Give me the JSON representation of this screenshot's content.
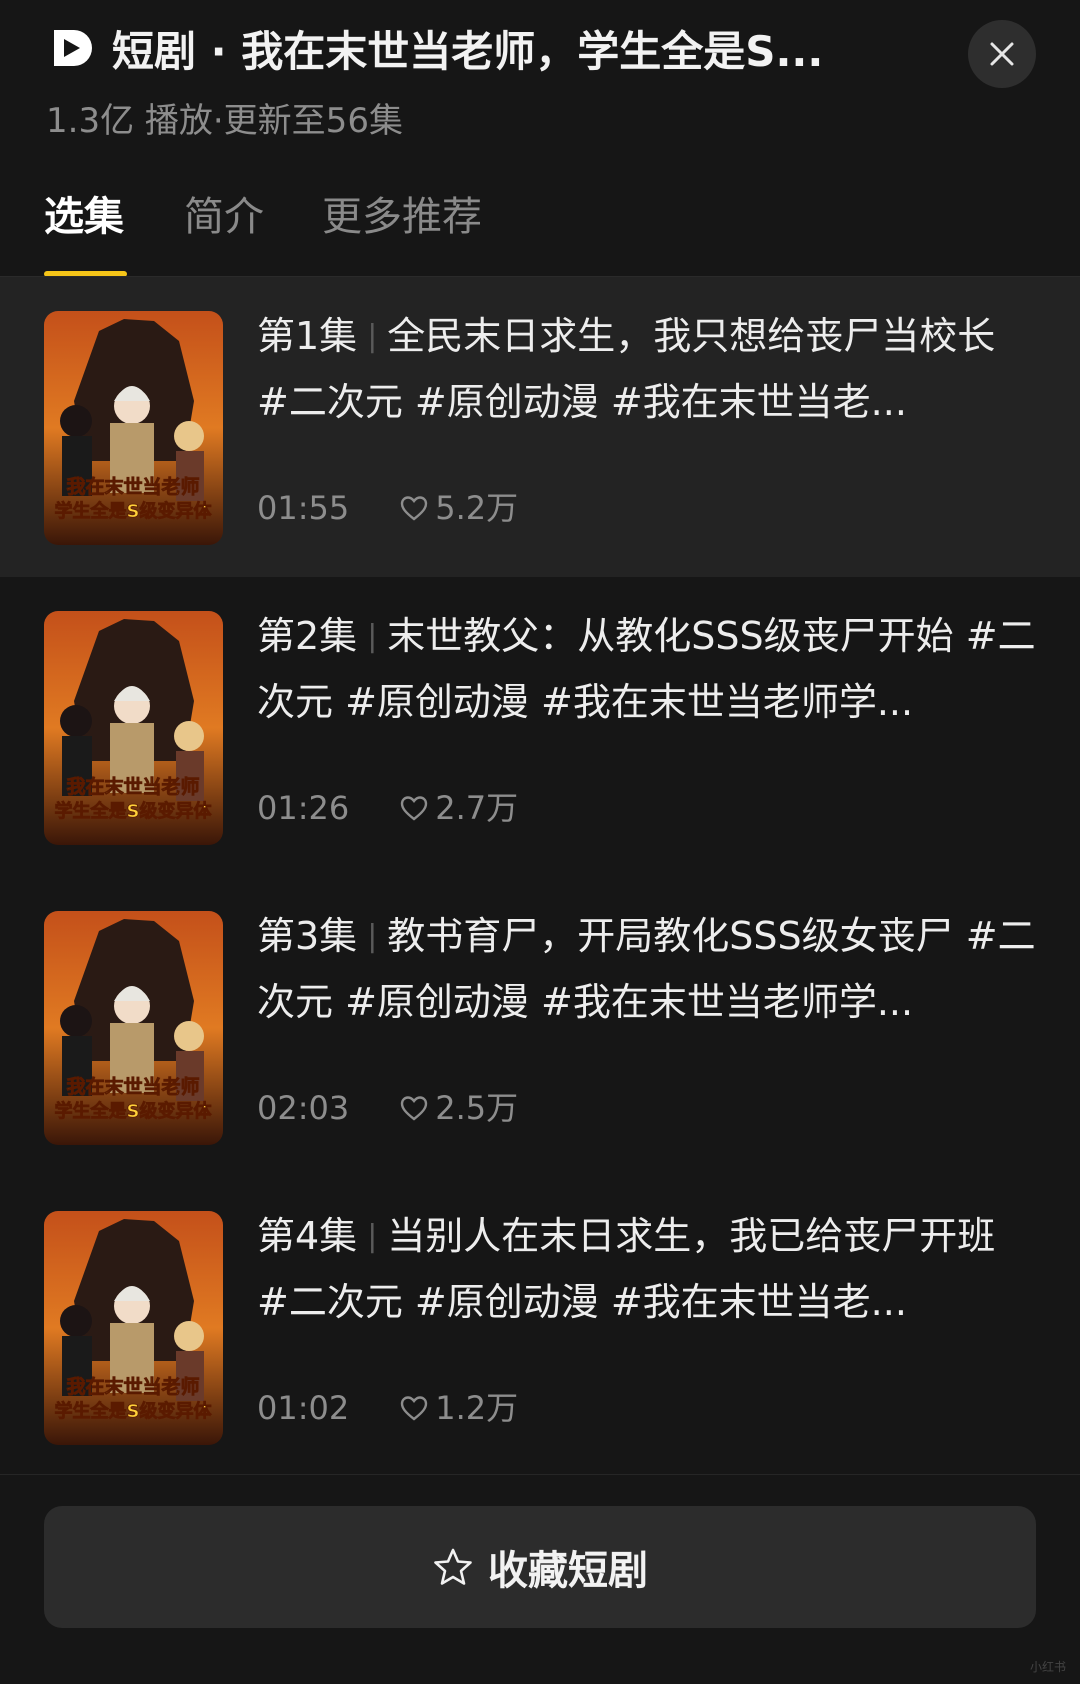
{
  "header": {
    "title": "短剧 · 我在末世当老师，学生全是S...",
    "meta": "1.3亿 播放·更新至56集"
  },
  "tabs": [
    {
      "label": "选集",
      "active": true
    },
    {
      "label": "简介",
      "active": false
    },
    {
      "label": "更多推荐",
      "active": false
    }
  ],
  "episodes": [
    {
      "ep": "第1集",
      "title": "全民末日求生，我只想给丧尸当校长  #二次元 #原创动漫 #我在末世当老...",
      "duration": "01:55",
      "likes": "5.2万",
      "active": true
    },
    {
      "ep": "第2集",
      "title": "末世教父：从教化SSS级丧尸开始 #二次元 #原创动漫 #我在末世当老师学...",
      "duration": "01:26",
      "likes": "2.7万",
      "active": false
    },
    {
      "ep": "第3集",
      "title": "教书育尸，开局教化SSS级女丧尸 #二次元 #原创动漫 #我在末世当老师学...",
      "duration": "02:03",
      "likes": "2.5万",
      "active": false
    },
    {
      "ep": "第4集",
      "title": "当别人在末日求生，我已给丧尸开班  #二次元 #原创动漫 #我在末世当老...",
      "duration": "01:02",
      "likes": "1.2万",
      "active": false
    }
  ],
  "thumb_text": {
    "line1": "我在末世当老师",
    "line2": "学生全是S级变异体"
  },
  "footer": {
    "favorite_label": "收藏短剧"
  },
  "colors": {
    "accent": "#f5c518",
    "background": "#161616",
    "active_row": "#232323"
  },
  "icons": {
    "logo": "play-logo-icon",
    "close": "close-icon",
    "like": "heart-icon",
    "favorite": "star-icon"
  },
  "watermark": "小红书"
}
